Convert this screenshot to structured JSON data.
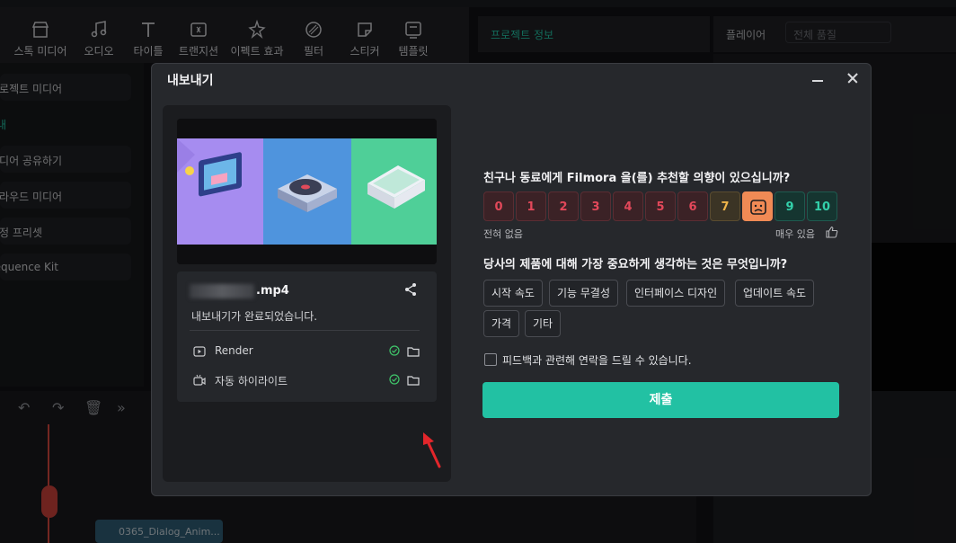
{
  "background": {
    "toolbar": [
      "스톡 미디어",
      "오디오",
      "타이틀",
      "트랜지션",
      "이펙트 효과",
      "필터",
      "스티커",
      "템플릿"
    ],
    "left_panel": [
      "프로젝트 미디어",
      "내",
      "미디어 공유하기",
      "클라우드 미디어",
      "조정 프리셋",
      "Sequence Kit"
    ],
    "project_tab": "프로젝트 정보",
    "player_label": "플레이어",
    "player_quality": "전체 품질",
    "timeline_clip": "0365_Dialog_Anim..."
  },
  "dialog": {
    "title": "내보내기",
    "file_name": ".mp4",
    "status": "내보내기가 완료되었습니다.",
    "outputs": [
      {
        "label": "Render",
        "icon": "play-icon"
      },
      {
        "label": "자동 하이라이트",
        "icon": "highlight-icon"
      }
    ],
    "question1": "친구나 동료에게 Filmora 을(를) 추천할 의향이 있으십니까?",
    "scores": [
      "0",
      "1",
      "2",
      "3",
      "4",
      "5",
      "6",
      "7",
      "8",
      "9",
      "10"
    ],
    "selected_score": "8",
    "low_label": "전혀 없음",
    "high_label": "매우 있음",
    "question2": "당사의 제품에 대해 가장 중요하게 생각하는 것은 무엇입니까?",
    "options": [
      "시작 속도",
      "기능 무결성",
      "인터페이스 디자인",
      "업데이트 속도",
      "가격",
      "기타"
    ],
    "consent": "피드백과 관련해 연락을 드릴 수 있습니다.",
    "submit": "제출"
  },
  "colors": {
    "accent": "#22c1a3",
    "negative": "#e2485a",
    "neutral": "#f0b54a",
    "selected": "#f08a55",
    "positive": "#33d1ab"
  }
}
